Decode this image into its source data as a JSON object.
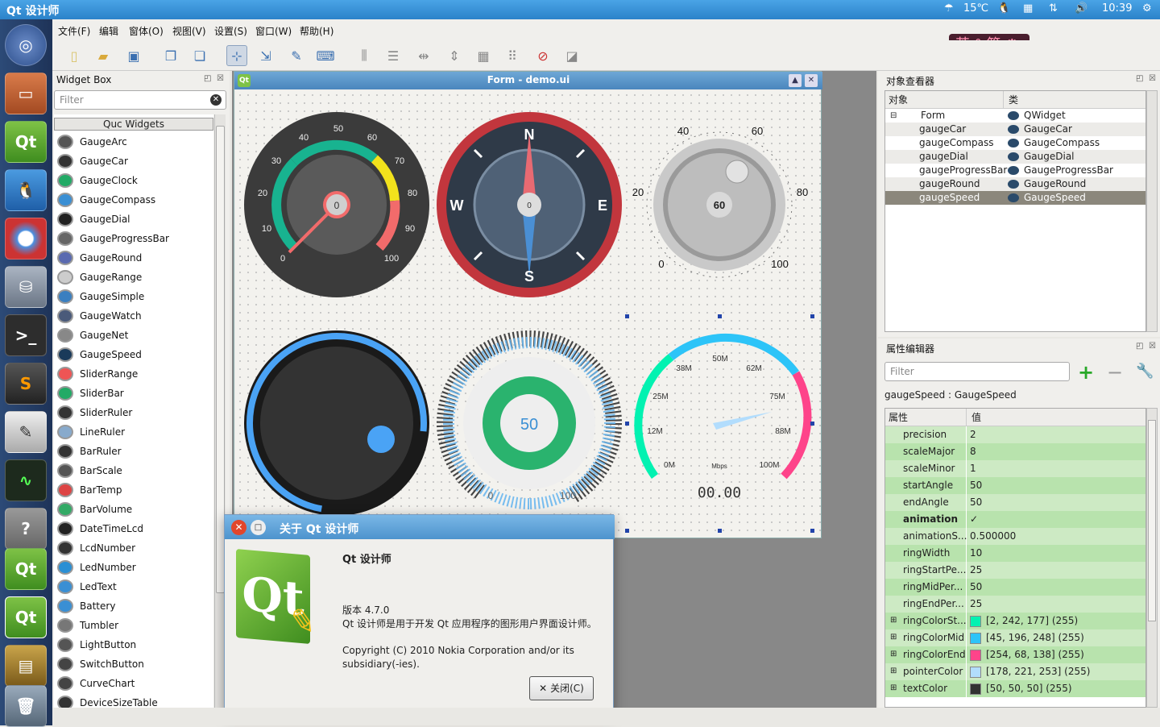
{
  "topbar": {
    "title": "Qt 设计师",
    "temperature": "15℃",
    "clock": "10:39"
  },
  "launcher": [
    "ubuntu-icon",
    "file-manager-icon",
    "qt-creator-icon",
    "qq-icon",
    "chromium-icon",
    "database-icon",
    "terminal-icon",
    "sublime-icon",
    "text-editor-icon",
    "system-monitor-icon",
    "help-icon",
    "qt-creator-icon",
    "qt-designer-icon",
    "archive-icon",
    "trash-icon"
  ],
  "menubar": {
    "items": [
      "文件(F)",
      "编辑",
      "窗体(O)",
      "视图(V)",
      "设置(S)",
      "窗口(W)",
      "帮助(H)"
    ]
  },
  "ime": {
    "label": "英 ° 简"
  },
  "widget_box": {
    "title": "Widget Box",
    "filter_placeholder": "Filter",
    "category": "Quc Widgets",
    "items": [
      "GaugeArc",
      "GaugeCar",
      "GaugeClock",
      "GaugeCompass",
      "GaugeDial",
      "GaugeProgressBar",
      "GaugeRound",
      "GaugeRange",
      "GaugeSimple",
      "GaugeWatch",
      "GaugeNet",
      "GaugeSpeed",
      "SliderRange",
      "SliderBar",
      "SliderRuler",
      "LineRuler",
      "BarRuler",
      "BarScale",
      "BarTemp",
      "BarVolume",
      "DateTimeLcd",
      "LcdNumber",
      "LedNumber",
      "LedText",
      "Battery",
      "Tumbler",
      "LightButton",
      "SwitchButton",
      "CurveChart",
      "DeviceSizeTable"
    ]
  },
  "form": {
    "title": "Form - demo.ui",
    "gauge_car": {
      "ticks": [
        "0",
        "10",
        "20",
        "30",
        "40",
        "50",
        "60",
        "70",
        "80",
        "90",
        "100"
      ],
      "value": "0"
    },
    "compass": {
      "n": "N",
      "s": "S",
      "e": "E",
      "w": "W",
      "value": "0"
    },
    "dial": {
      "ticks": [
        "0",
        "20",
        "40",
        "60",
        "80",
        "100"
      ],
      "value": "60"
    },
    "round": {},
    "progress": {
      "value": "50",
      "min": "0",
      "max": "100"
    },
    "speed": {
      "ticks": [
        "0M",
        "12M",
        "25M",
        "38M",
        "50M",
        "62M",
        "75M",
        "88M",
        "100M"
      ],
      "unit": "Mbps",
      "lcd": "00.00"
    }
  },
  "object_inspector": {
    "title": "对象查看器",
    "col_object": "对象",
    "col_class": "类",
    "rows": [
      {
        "name": "Form",
        "cls": "QWidget"
      },
      {
        "name": "gaugeCar",
        "cls": "GaugeCar"
      },
      {
        "name": "gaugeCompass",
        "cls": "GaugeCompass"
      },
      {
        "name": "gaugeDial",
        "cls": "GaugeDial"
      },
      {
        "name": "gaugeProgressBar",
        "cls": "GaugeProgressBar"
      },
      {
        "name": "gaugeRound",
        "cls": "GaugeRound"
      },
      {
        "name": "gaugeSpeed",
        "cls": "GaugeSpeed"
      }
    ]
  },
  "property_editor": {
    "title": "属性编辑器",
    "filter_placeholder": "Filter",
    "context": "gaugeSpeed : GaugeSpeed",
    "col_prop": "属性",
    "col_value": "值",
    "rows": [
      {
        "n": "precision",
        "v": "2"
      },
      {
        "n": "scaleMajor",
        "v": "8"
      },
      {
        "n": "scaleMinor",
        "v": "1"
      },
      {
        "n": "startAngle",
        "v": "50"
      },
      {
        "n": "endAngle",
        "v": "50"
      },
      {
        "n": "animation",
        "v": "✓"
      },
      {
        "n": "animationS...",
        "v": "0.500000"
      },
      {
        "n": "ringWidth",
        "v": "10"
      },
      {
        "n": "ringStartPe...",
        "v": "25"
      },
      {
        "n": "ringMidPer...",
        "v": "50"
      },
      {
        "n": "ringEndPer...",
        "v": "25"
      },
      {
        "n": "ringColorSt...",
        "v": "[2, 242, 177] (255)",
        "color": "#02f2b1"
      },
      {
        "n": "ringColorMid",
        "v": "[45, 196, 248] (255)",
        "color": "#2dc4f8"
      },
      {
        "n": "ringColorEnd",
        "v": "[254, 68, 138] (255)",
        "color": "#fe448a"
      },
      {
        "n": "pointerColor",
        "v": "[178, 221, 253] (255)",
        "color": "#b2ddfd"
      },
      {
        "n": "textColor",
        "v": "[50, 50, 50] (255)",
        "color": "#323232"
      }
    ]
  },
  "about": {
    "title": "关于 Qt 设计师",
    "heading": "Qt 设计师",
    "version": "版本 4.7.0",
    "desc": "Qt 设计师是用于开发 Qt 应用程序的图形用户界面设计师。",
    "copyright": "Copyright (C) 2010 Nokia Corporation and/or its subsidiary(-ies).",
    "close": "关闭(C)",
    "logo": "Qt"
  }
}
